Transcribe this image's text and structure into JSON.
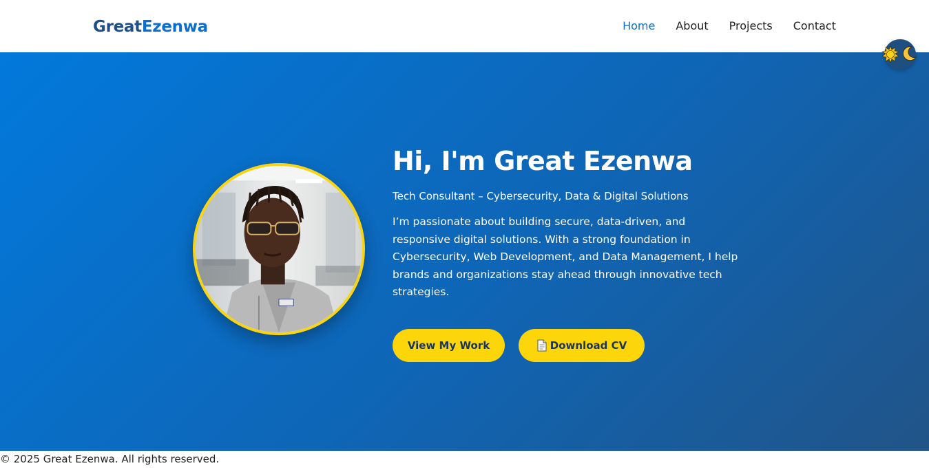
{
  "header": {
    "logo_part1": "Great",
    "logo_part2": "Ezenwa",
    "nav": [
      {
        "label": "Home",
        "active": true
      },
      {
        "label": "About",
        "active": false
      },
      {
        "label": "Projects",
        "active": false
      },
      {
        "label": "Contact",
        "active": false
      }
    ]
  },
  "theme_toggle": {
    "icons": [
      "sun-icon",
      "moon-icon"
    ]
  },
  "hero": {
    "title": "Hi, I'm Great Ezenwa",
    "subtitle": "Tech Consultant – Cybersecurity, Data & Digital Solutions",
    "description": "I’m passionate about building secure, data-driven, and responsive digital solutions. With a strong foundation in Cybersecurity, Web Development, and Data Management, I help brands and organizations stay ahead through innovative tech strategies.",
    "buttons": {
      "view_work": "View My Work",
      "download_cv": "Download CV"
    }
  },
  "footer": {
    "text": "© 2025 Great Ezenwa. All rights reserved."
  },
  "colors": {
    "brand_dark": "#1f4f86",
    "brand_blue": "#0a6fcf",
    "accent_yellow": "#fcd60a",
    "hero_gradient_start": "#0279dc",
    "hero_gradient_end": "#215488"
  }
}
